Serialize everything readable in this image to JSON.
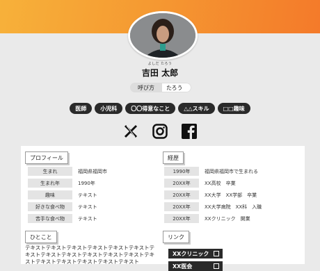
{
  "profile": {
    "ruby": "よしだ たろう",
    "name": "吉田 太郎",
    "nickname_label": "呼び方",
    "nickname_value": "たろう"
  },
  "tags": [
    "医師",
    "小児科",
    "〇〇得意なこと",
    "△△スキル",
    "□□趣味"
  ],
  "sns": [
    "x-icon",
    "instagram-icon",
    "facebook-icon"
  ],
  "sections": {
    "profile_title": "プロフィール",
    "profile_rows": [
      {
        "k": "生まれ",
        "v": "福岡県福岡市"
      },
      {
        "k": "生まれ年",
        "v": "1990年"
      },
      {
        "k": "趣味",
        "v": "テキスト"
      },
      {
        "k": "好きな食べ物",
        "v": "テキスト"
      },
      {
        "k": "苦手な食べ物",
        "v": "テキスト"
      }
    ],
    "career_title": "経歴",
    "career_rows": [
      {
        "k": "1990年",
        "v": "福岡県福岡市で生まれる"
      },
      {
        "k": "20XX年",
        "v": "XX高校　卒業"
      },
      {
        "k": "20XX年",
        "v": "XX大学　XX学部　卒業"
      },
      {
        "k": "20XX年",
        "v": "XX大学病院　XX科　入職"
      },
      {
        "k": "20XX年",
        "v": "XXクリニック　開業"
      }
    ],
    "comment_title": "ひとこと",
    "comment_text": "テキストテキストテキストテキストテキストテキストテキストテキストテキストテキストテキストテキストテキストテキストテキストテキストテキストテキスト",
    "link_title": "リンク",
    "links": [
      "XXクリニック",
      "XX医会"
    ]
  },
  "colors": {
    "accent_start": "#f7b13a",
    "accent_end": "#f47a2a",
    "dark": "#2a2a2a"
  }
}
